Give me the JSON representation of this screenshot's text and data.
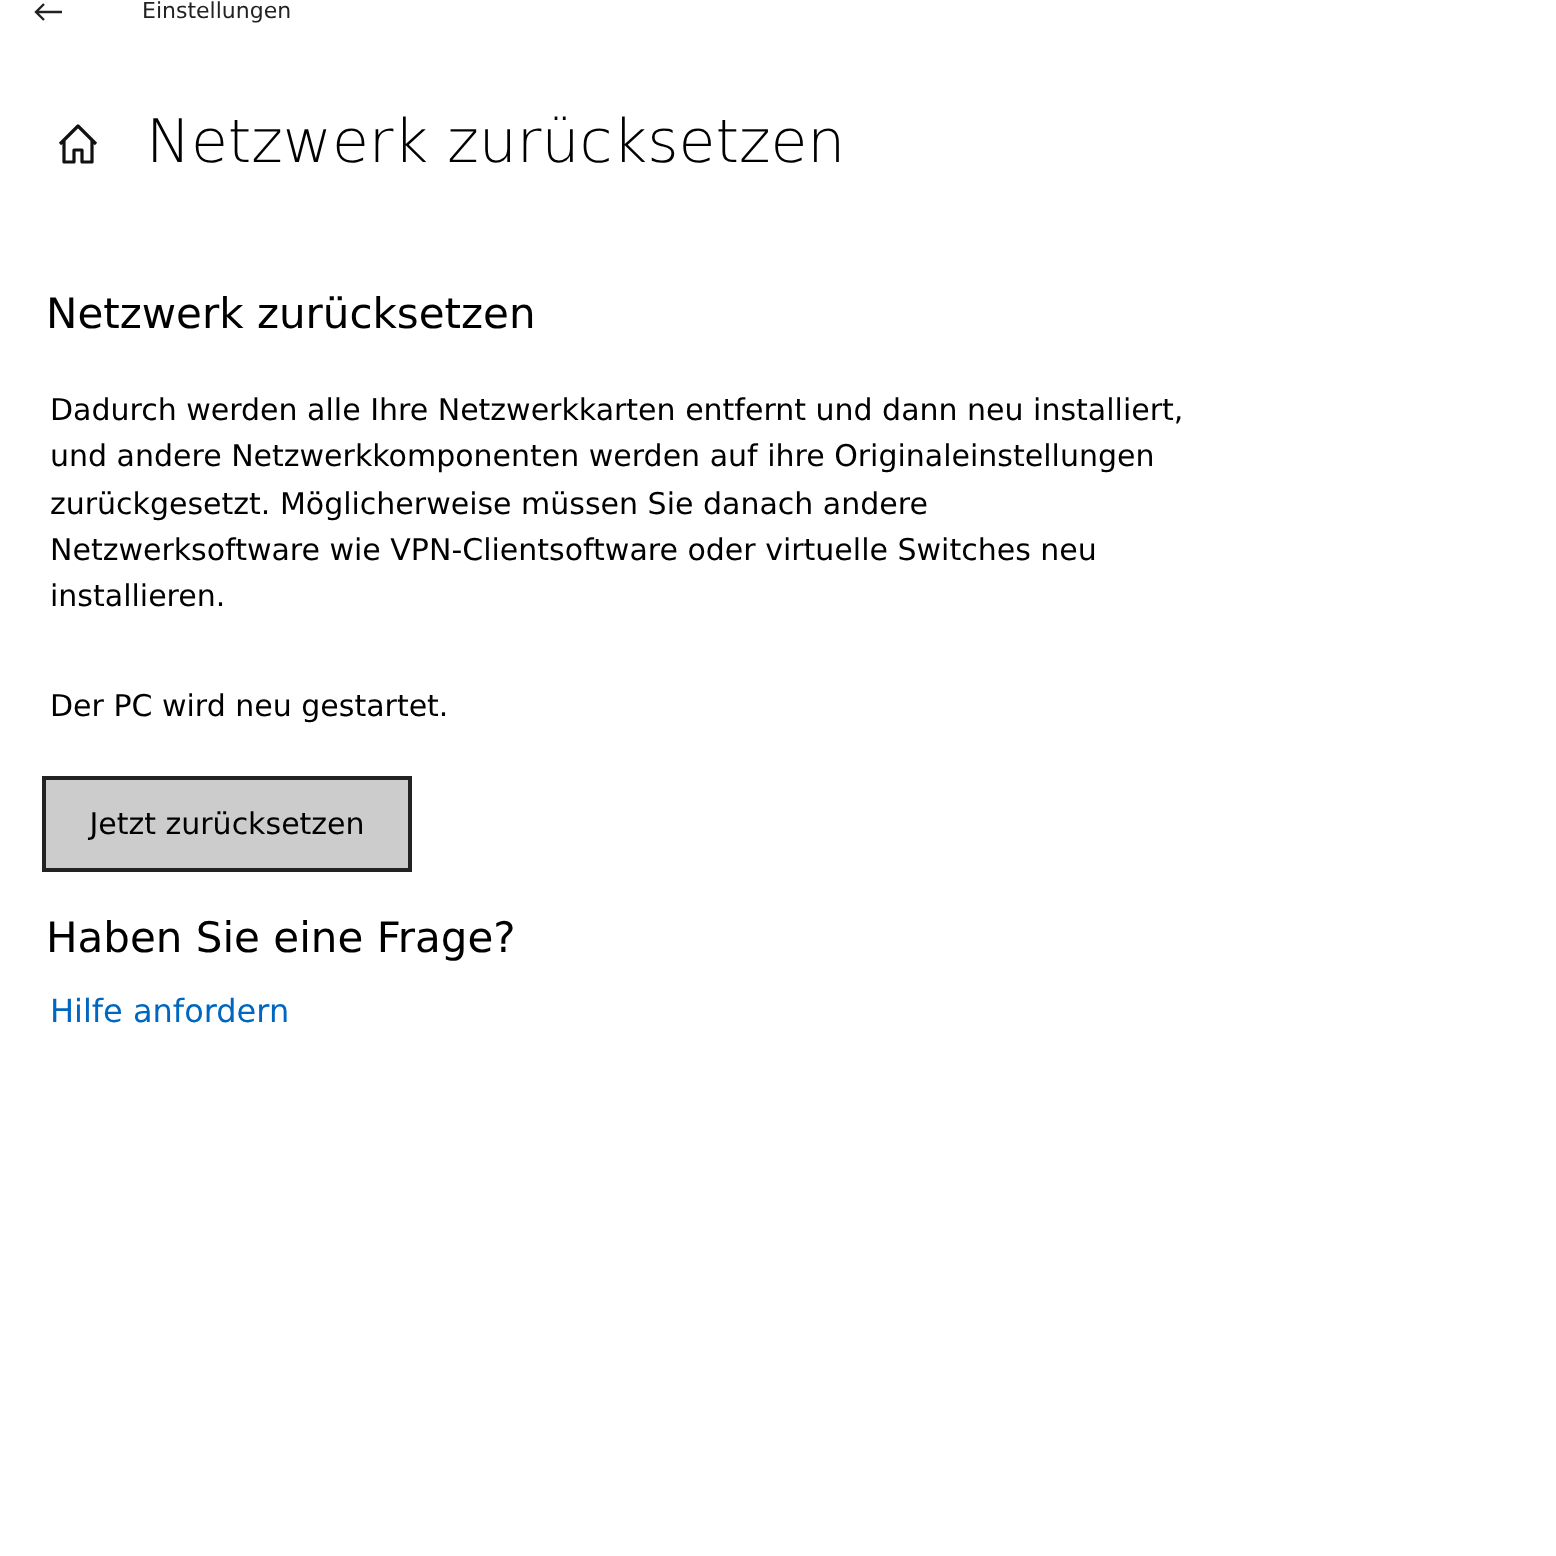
{
  "window": {
    "title": "Einstellungen"
  },
  "page_title": "Netzwerk zurücksetzen",
  "section": {
    "heading": "Netzwerk zurücksetzen",
    "description": "Dadurch werden alle Ihre Netzwerkkarten entfernt und dann neu installiert, und andere Netzwerkkomponenten werden auf ihre Originaleinstellungen zurückgesetzt. Möglicherweise müssen Sie danach andere Netzwerksoftware wie VPN-Clientsoftware oder virtuelle Switches neu installieren.",
    "note": "Der PC wird neu gestartet.",
    "button": "Jetzt zurücksetzen"
  },
  "help": {
    "heading": "Haben Sie eine Frage?",
    "link": "Hilfe anfordern"
  }
}
